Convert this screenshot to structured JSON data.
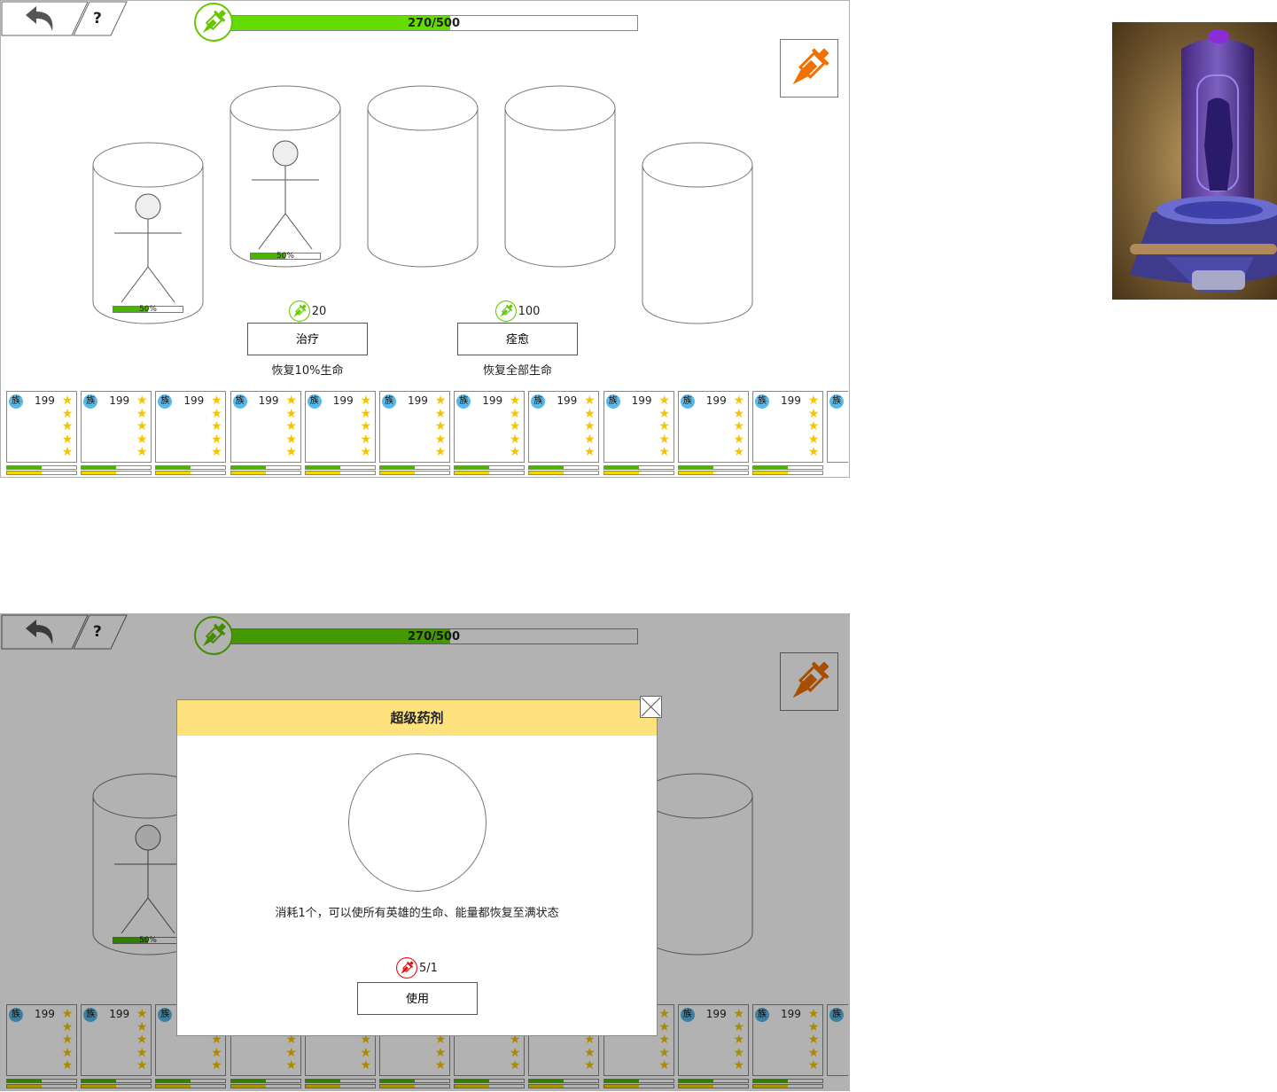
{
  "top_bar": {
    "help_label": "?",
    "energy_text": "270/500",
    "energy_value": 270,
    "energy_max": 500,
    "energy_color": "#64dc00"
  },
  "icons": {
    "back": "back-arrow-icon",
    "potion_green": "dropper-potion-icon",
    "potion_orange": "dropper-potion-icon",
    "potion_red": "dropper-potion-icon",
    "close": "close-icon"
  },
  "colors": {
    "potion_green": "#64c800",
    "potion_orange": "#f07000",
    "potion_red": "#e01010",
    "hp": "#4ab500",
    "energy": "#f0d800",
    "star": "#f5c400",
    "clan": "#59b8e6",
    "modal_header": "#fee27d"
  },
  "tanks": [
    {
      "has_hero": true,
      "hp_text": "50%",
      "hp_fraction": 0.5
    },
    {
      "has_hero": true,
      "hp_text": "50%",
      "hp_fraction": 0.5
    },
    {
      "has_hero": false
    },
    {
      "has_hero": false
    },
    {
      "has_hero": false
    }
  ],
  "actions": [
    {
      "cost": "20",
      "label": "治疗",
      "desc": "恢复10%生命"
    },
    {
      "cost": "100",
      "label": "痊愈",
      "desc": "恢复全部生命"
    }
  ],
  "cards": [
    {
      "clan": "族",
      "level": "199",
      "stars": 5,
      "hp_fraction": 0.5,
      "energy_fraction": 0.5
    },
    {
      "clan": "族",
      "level": "199",
      "stars": 5,
      "hp_fraction": 0.5,
      "energy_fraction": 0.5
    },
    {
      "clan": "族",
      "level": "199",
      "stars": 5,
      "hp_fraction": 0.5,
      "energy_fraction": 0.5
    },
    {
      "clan": "族",
      "level": "199",
      "stars": 5,
      "hp_fraction": 0.5,
      "energy_fraction": 0.5
    },
    {
      "clan": "族",
      "level": "199",
      "stars": 5,
      "hp_fraction": 0.5,
      "energy_fraction": 0.5
    },
    {
      "clan": "族",
      "level": "199",
      "stars": 5,
      "hp_fraction": 0.5,
      "energy_fraction": 0.5
    },
    {
      "clan": "族",
      "level": "199",
      "stars": 5,
      "hp_fraction": 0.5,
      "energy_fraction": 0.5
    },
    {
      "clan": "族",
      "level": "199",
      "stars": 5,
      "hp_fraction": 0.5,
      "energy_fraction": 0.5
    },
    {
      "clan": "族",
      "level": "199",
      "stars": 5,
      "hp_fraction": 0.5,
      "energy_fraction": 0.5
    },
    {
      "clan": "族",
      "level": "199",
      "stars": 5,
      "hp_fraction": 0.5,
      "energy_fraction": 0.5
    },
    {
      "clan": "族",
      "level": "199",
      "stars": 5,
      "hp_fraction": 0.5,
      "energy_fraction": 0.5
    },
    {
      "clan": "族",
      "level": "",
      "stars": 0,
      "hp_fraction": 0,
      "energy_fraction": 0
    }
  ],
  "modal": {
    "title": "超级药剂",
    "desc": "消耗1个，可以使所有英雄的生命、能量都恢复至满状态",
    "count": "5/1",
    "use_label": "使用"
  },
  "preview": {
    "subject": "hero-healing-tank-render"
  }
}
